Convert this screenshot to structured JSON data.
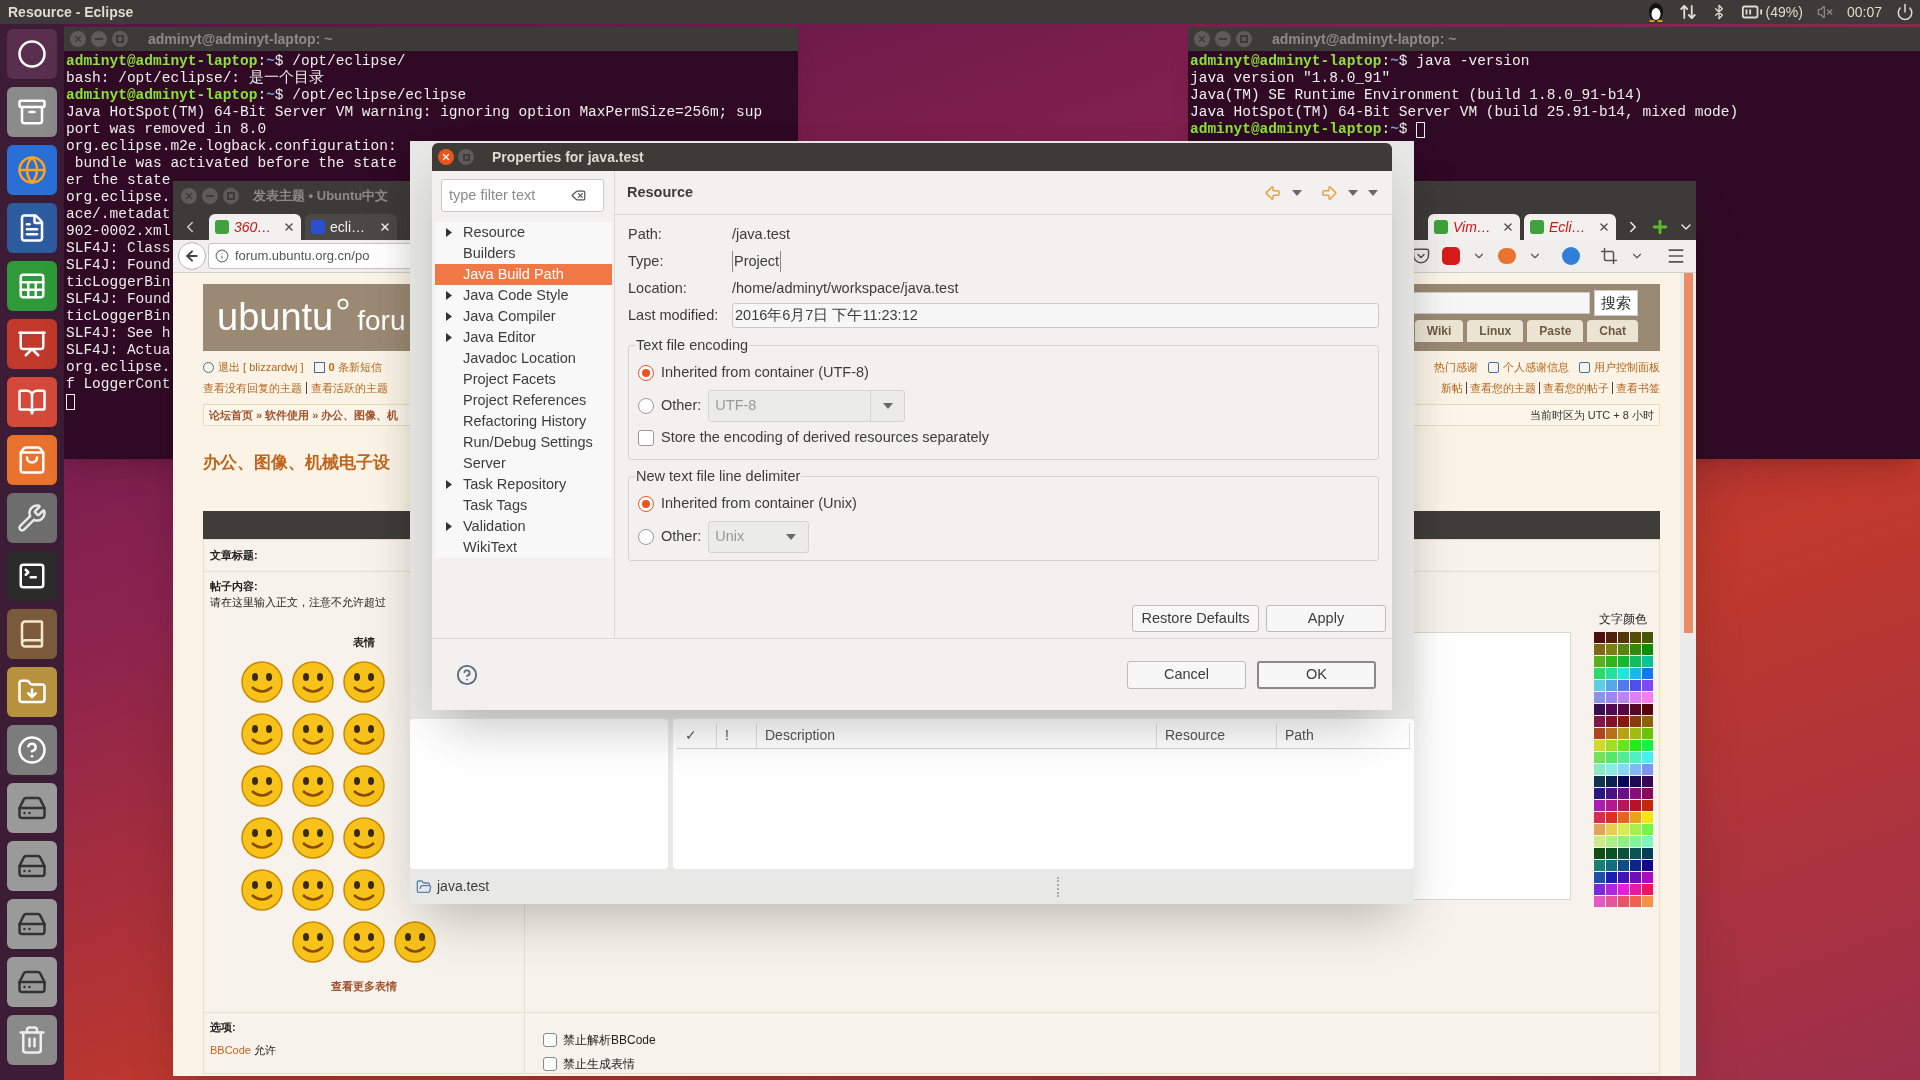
{
  "top_bar": {
    "title": "Resource - Eclipse",
    "battery": "(49%)",
    "clock": "00:07"
  },
  "terminals": [
    {
      "title": "adminyt@adminyt-laptop: ~",
      "lines": [
        {
          "kind": "prompt",
          "user": "adminyt@adminyt-laptop",
          "sep": ":",
          "path": "~",
          "symbol": "$",
          "command": "/opt/eclipse/",
          "cursor": false
        },
        {
          "kind": "output",
          "text": "bash: /opt/eclipse/: 是一个目录"
        },
        {
          "kind": "prompt",
          "user": "adminyt@adminyt-laptop",
          "sep": ":",
          "path": "~",
          "symbol": "$",
          "command": "/opt/eclipse/eclipse",
          "cursor": false
        },
        {
          "kind": "output",
          "text": "Java HotSpot(TM) 64-Bit Server VM warning: ignoring option MaxPermSize=256m; sup"
        },
        {
          "kind": "output",
          "text": "port was removed in 8.0"
        },
        {
          "kind": "output",
          "text": "org.eclipse.m2e.logback.configuration:"
        },
        {
          "kind": "output",
          "text": " bundle was activated before the state"
        },
        {
          "kind": "output",
          "text": "er the state"
        },
        {
          "kind": "output",
          "text": "org.eclipse."
        },
        {
          "kind": "output",
          "text": "ace/.metadat"
        },
        {
          "kind": "output",
          "text": "902-0002.xml"
        },
        {
          "kind": "output",
          "text": "SLF4J: Class"
        },
        {
          "kind": "output",
          "text": "SLF4J: Found"
        },
        {
          "kind": "output",
          "text": "ticLoggerBin"
        },
        {
          "kind": "output",
          "text": "SLF4J: Found"
        },
        {
          "kind": "output",
          "text": "ticLoggerBin"
        },
        {
          "kind": "output",
          "text": "SLF4J: See h"
        },
        {
          "kind": "output",
          "text": "SLF4J: Actua"
        },
        {
          "kind": "output",
          "text": "org.eclipse."
        },
        {
          "kind": "output",
          "text": "f LoggerCont"
        },
        {
          "kind": "cursor"
        }
      ]
    },
    {
      "title": "adminyt@adminyt-laptop: ~",
      "lines": [
        {
          "kind": "prompt",
          "user": "adminyt@adminyt-laptop",
          "sep": ":",
          "path": "~",
          "symbol": "$",
          "command": "java -version",
          "cursor": false
        },
        {
          "kind": "output",
          "text": "java version \"1.8.0_91\""
        },
        {
          "kind": "output",
          "text": "Java(TM) SE Runtime Environment (build 1.8.0_91-b14)"
        },
        {
          "kind": "output",
          "text": "Java HotSpot(TM) 64-Bit Server VM (build 25.91-b14, mixed mode)"
        },
        {
          "kind": "prompt",
          "user": "adminyt@adminyt-laptop",
          "sep": ":",
          "path": "~",
          "symbol": "$",
          "cursor": true
        }
      ]
    }
  ],
  "browser": {
    "title": "发表主题 • Ubuntu中文",
    "tabs_left": [
      {
        "label": "360…",
        "kind": "pending"
      },
      {
        "label": "ecli…",
        "kind": "normal"
      }
    ],
    "tabs_right": [
      {
        "label": "Vim…",
        "kind": "pending"
      },
      {
        "label": "Ecli…",
        "kind": "pending"
      }
    ],
    "url": "forum.ubuntu.org.cn/po"
  },
  "site": {
    "logo": "ubuntu",
    "logo_suffix": "foru",
    "search_button": "搜索",
    "nav_tabs": [
      "Wiki",
      "Linux",
      "Paste",
      "Chat"
    ],
    "logout": "退出 [ blizzardwj ]",
    "messages": "**0** 条新短信",
    "left_links": [
      "查看没有回复的主题",
      "查看活跃的主题"
    ],
    "right_links": [
      "热门感谢",
      "个人感谢信息",
      "用户控制面板"
    ],
    "right_links_2": [
      "新帖",
      "查看您的主题",
      "查看您的帖子",
      "查看书签"
    ],
    "breadcrumb": "论坛首页 » 软件使用 » 办公、图像、机",
    "timezone": "当前时区为 UTC + 8 小时",
    "heading": "办公、图像、机械电子设",
    "form": {
      "title_label": "文章标题:",
      "content_label": "帖子内容:",
      "hint": "请在这里输入正文，注意不允许超过",
      "smilies_title": "表情",
      "more_smilies": "查看更多表情",
      "color_label": "文字颜色",
      "options_label": "选项:",
      "bbcode_link": "BBCode",
      "bbcode_state": "允许",
      "checkboxes": [
        {
          "label": "禁止解析BBCode",
          "checked": false
        },
        {
          "label": "禁止生成表情",
          "checked": false
        }
      ]
    }
  },
  "eclipse": {
    "problems_columns": [
      "✓",
      "!",
      "Description",
      "Resource",
      "Path"
    ],
    "status": "java.test"
  },
  "dialog": {
    "title": "Properties for java.test",
    "filter_placeholder": "type filter text",
    "tree": [
      {
        "label": "Resource",
        "kind": "branch",
        "selected": false
      },
      {
        "label": "Builders",
        "kind": "leaf",
        "selected": false
      },
      {
        "label": "Java Build Path",
        "kind": "leaf",
        "selected": true
      },
      {
        "label": "Java Code Style",
        "kind": "branch",
        "selected": false
      },
      {
        "label": "Java Compiler",
        "kind": "branch",
        "selected": false
      },
      {
        "label": "Java Editor",
        "kind": "branch",
        "selected": false
      },
      {
        "label": "Javadoc Location",
        "kind": "leaf",
        "selected": false
      },
      {
        "label": "Project Facets",
        "kind": "leaf",
        "selected": false
      },
      {
        "label": "Project References",
        "kind": "leaf",
        "selected": false
      },
      {
        "label": "Refactoring History",
        "kind": "leaf",
        "selected": false
      },
      {
        "label": "Run/Debug Settings",
        "kind": "leaf",
        "selected": false
      },
      {
        "label": "Server",
        "kind": "leaf",
        "selected": false
      },
      {
        "label": "Task Repository",
        "kind": "branch",
        "selected": false
      },
      {
        "label": "Task Tags",
        "kind": "leaf",
        "selected": false
      },
      {
        "label": "Validation",
        "kind": "branch",
        "selected": false
      },
      {
        "label": "WikiText",
        "kind": "leaf",
        "selected": false
      }
    ],
    "page_title": "Resource",
    "fields": [
      {
        "label": "Path:",
        "value": "/java.test",
        "kind": "text"
      },
      {
        "label": "Type:",
        "value": "Project",
        "kind": "selectable"
      },
      {
        "label": "Location:",
        "value": "/home/adminyt/workspace/java.test",
        "kind": "text"
      },
      {
        "label": "Last modified:",
        "value": "2016年6月7日 下午11:23:12",
        "kind": "field"
      }
    ],
    "groups": [
      {
        "title": "Text file encoding",
        "options": [
          {
            "label": "Inherited from container (UTF-8)",
            "selected": true
          },
          {
            "label": "Other:",
            "selected": false,
            "combo": {
              "value": "UTF-8",
              "disabled": true
            }
          }
        ],
        "checkbox": {
          "label": "Store the encoding of derived resources separately",
          "checked": false
        }
      },
      {
        "title": "New text file line delimiter",
        "options": [
          {
            "label": "Inherited from container (Unix)",
            "selected": true
          },
          {
            "label": "Other:",
            "selected": false,
            "combo": {
              "value": "Unix",
              "disabled": true
            }
          }
        ]
      }
    ],
    "buttons": [
      "Restore Defaults",
      "Apply"
    ],
    "footer_buttons": [
      {
        "label": "Cancel",
        "default": false
      },
      {
        "label": "OK",
        "default": true
      }
    ]
  }
}
